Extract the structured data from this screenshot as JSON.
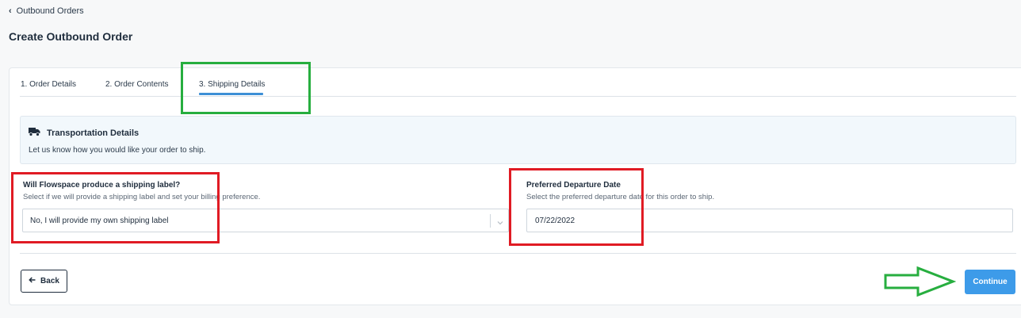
{
  "breadcrumb": {
    "label": "Outbound Orders"
  },
  "page": {
    "title": "Create Outbound Order"
  },
  "tabs": [
    {
      "label": "1. Order Details",
      "active": false
    },
    {
      "label": "2. Order Contents",
      "active": false
    },
    {
      "label": "3. Shipping Details",
      "active": true
    }
  ],
  "transport": {
    "title": "Transportation Details",
    "subtitle": "Let us know how you would like your order to ship.",
    "icon": "truck-icon"
  },
  "shipping_label": {
    "label": "Will Flowspace produce a shipping label?",
    "help": "Select if we will provide a shipping label and set your billing preference.",
    "value": "No, I will provide my own shipping label"
  },
  "departure": {
    "label": "Preferred Departure Date",
    "help": "Select the preferred departure date for this order to ship.",
    "value": "07/22/2022"
  },
  "actions": {
    "back_label": "Back",
    "continue_label": "Continue"
  },
  "colors": {
    "accent": "#3d9be9",
    "tab_underline": "#3d8fd6",
    "annotation_green": "#27ae3f",
    "annotation_red": "#e01b24"
  }
}
